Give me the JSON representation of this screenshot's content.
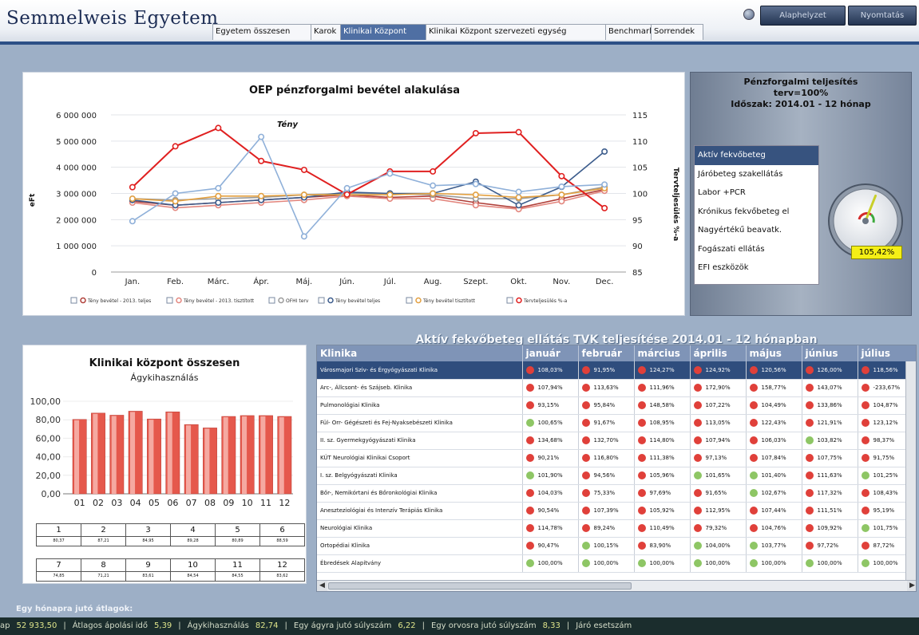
{
  "app": {
    "title": "Semmelweis Egyetem"
  },
  "tabs": [
    {
      "label": "Egyetem összesen"
    },
    {
      "label": "Karok"
    },
    {
      "label": "Klinikai Központ"
    },
    {
      "label": "Klinikai Központ szervezeti egység"
    },
    {
      "label": "Benchmark"
    },
    {
      "label": "Sorrendek"
    }
  ],
  "top_buttons": {
    "reset": "Alaphelyzet",
    "print": "Nyomtatás"
  },
  "main_chart": {
    "title": "OEP pénzforgalmi bevétel alakulása",
    "ylabel_left": "eFt",
    "ylabel_right": "Tervteljesülés %-a",
    "annotation": "Tény",
    "legend": [
      {
        "label": "Tény bevétel - 2013. teljes",
        "color": "#b0403a"
      },
      {
        "label": "Tény bevétel - 2013. tisztított",
        "color": "#e3877f"
      },
      {
        "label": "OFHI terv",
        "color": "#9b9b9b"
      },
      {
        "label": "Tény bevétel teljes",
        "color": "#3c5c8c"
      },
      {
        "label": "Tény bevétel tisztított",
        "color": "#e3a040"
      },
      {
        "label": "Tervteljesülés %-a",
        "color": "#e02020"
      }
    ]
  },
  "chart_data": {
    "type": "line",
    "title": "OEP pénzforgalmi bevétel alakulása",
    "ylabel": "eFt",
    "y2label": "Tervteljesülés %-a",
    "categories": [
      "Jan.",
      "Feb.",
      "Márc.",
      "Ápr.",
      "Máj.",
      "Jún.",
      "Júl.",
      "Aug.",
      "Szept.",
      "Okt.",
      "Nov.",
      "Dec."
    ],
    "ylim": [
      0,
      6000000
    ],
    "y2lim": [
      85,
      115
    ],
    "yticks": [
      "0",
      "1 000 000",
      "2 000 000",
      "3 000 000",
      "4 000 000",
      "5 000 000",
      "6 000 000"
    ],
    "y2ticks": [
      "85",
      "90",
      "95",
      "100",
      "105",
      "110",
      "115"
    ],
    "legend_position": "bottom",
    "series": [
      {
        "name": "Tény bevétel - 2013. teljes",
        "axis": "left",
        "color": "#b0403a",
        "values": [
          2700000,
          2550000,
          2650000,
          2750000,
          2850000,
          2950000,
          2850000,
          2900000,
          2650000,
          2450000,
          2800000,
          3150000
        ]
      },
      {
        "name": "Tény bevétel - 2013. tisztított",
        "axis": "left",
        "color": "#e3877f",
        "values": [
          2650000,
          2450000,
          2550000,
          2650000,
          2750000,
          2900000,
          2800000,
          2800000,
          2550000,
          2400000,
          2700000,
          3100000
        ]
      },
      {
        "name": "OFHI terv",
        "axis": "left",
        "color": "#9b9b9b",
        "values": [
          2800000,
          2750000,
          2800000,
          2850000,
          2950000,
          3000000,
          3000000,
          2950000,
          2800000,
          2800000,
          2950000,
          3250000
        ]
      },
      {
        "name": "Tény bevétel teljes",
        "axis": "left",
        "color": "#3c5c8c",
        "values": [
          2750000,
          2550000,
          2650000,
          2750000,
          2850000,
          3050000,
          3000000,
          3000000,
          3450000,
          2550000,
          3250000,
          4600000
        ]
      },
      {
        "name": "Tény bevétel tisztított",
        "axis": "left",
        "color": "#e3a040",
        "values": [
          2800000,
          2700000,
          2900000,
          2900000,
          2950000,
          2950000,
          2950000,
          3000000,
          2950000,
          2850000,
          2950000,
          3200000
        ]
      },
      {
        "name": "Tervteljesülés %-a",
        "axis": "right",
        "color": "#e02020",
        "values": [
          101.2,
          109.0,
          112.5,
          106.2,
          104.5,
          99.8,
          104.2,
          104.2,
          111.5,
          111.7,
          103.3,
          97.2
        ]
      },
      {
        "name": "",
        "axis": "right",
        "color": "#8fb0d9",
        "values": [
          94.7,
          100.0,
          101.0,
          110.8,
          91.8,
          101.0,
          103.8,
          101.5,
          101.8,
          100.3,
          101.3,
          101.7
        ]
      }
    ]
  },
  "perf": {
    "title1": "Pénzforgalmi teljesítés",
    "title2": "terv=100%",
    "title3": "Időszak: 2014.01 - 12 hónap",
    "items": [
      "Aktív fekvőbeteg",
      "Járóbeteg szakellátás",
      "Labor +PCR",
      "Krónikus fekvőbeteg el",
      "Nagyértékű beavatk.",
      "Fogászati ellátás",
      "EFI eszközök"
    ],
    "gauge_value": "105,42%",
    "gauge_percent": 105.42
  },
  "bar_chart": {
    "title": "Klinikai központ összesen",
    "subtitle": "Ágykihasználás",
    "color": "#e5584c",
    "categories": [
      "01",
      "02",
      "03",
      "04",
      "05",
      "06",
      "07",
      "08",
      "09",
      "10",
      "11",
      "12"
    ],
    "values": [
      80.37,
      87.21,
      84.95,
      89.28,
      80.89,
      88.59,
      74.85,
      71.21,
      83.61,
      84.54,
      84.55,
      83.62
    ],
    "yticks": [
      "0,00",
      "20,00",
      "40,00",
      "60,00",
      "80,00",
      "100,00"
    ],
    "ylim": [
      0,
      100
    ]
  },
  "month_grid": {
    "row1": {
      "months": [
        "1",
        "2",
        "3",
        "4",
        "5",
        "6"
      ],
      "values": [
        "80,37",
        "87,21",
        "84,95",
        "89,28",
        "80,89",
        "88,59"
      ]
    },
    "row2": {
      "months": [
        "7",
        "8",
        "9",
        "10",
        "11",
        "12"
      ],
      "values": [
        "74,85",
        "71,21",
        "83,61",
        "84,54",
        "84,55",
        "83,62"
      ]
    }
  },
  "table": {
    "title": "Aktív fekvőbeteg ellátás TVK teljesítése 2014.01 - 12 hónapban",
    "headers": [
      "Klinika",
      "január",
      "február",
      "március",
      "április",
      "május",
      "június",
      "július"
    ],
    "rows": [
      {
        "name": "Városmajori Sziv- és Érgyógyászati Klinika",
        "selected": true,
        "cells": [
          {
            "v": "108,03%",
            "s": "red"
          },
          {
            "v": "91,95%",
            "s": "red"
          },
          {
            "v": "124,27%",
            "s": "red"
          },
          {
            "v": "124,92%",
            "s": "red"
          },
          {
            "v": "120,56%",
            "s": "red"
          },
          {
            "v": "126,00%",
            "s": "red"
          },
          {
            "v": "118,56%",
            "s": "red"
          }
        ]
      },
      {
        "name": "Arc-, Állcsont- és Szájseb. Klinika",
        "selected": false,
        "cells": [
          {
            "v": "107,94%",
            "s": "red"
          },
          {
            "v": "113,63%",
            "s": "red"
          },
          {
            "v": "111,96%",
            "s": "red"
          },
          {
            "v": "172,90%",
            "s": "red"
          },
          {
            "v": "158,77%",
            "s": "red"
          },
          {
            "v": "143,07%",
            "s": "red"
          },
          {
            "v": "-233,67%",
            "s": "red"
          }
        ]
      },
      {
        "name": "Pulmonológiai Klinika",
        "selected": false,
        "cells": [
          {
            "v": "93,15%",
            "s": "red"
          },
          {
            "v": "95,84%",
            "s": "red"
          },
          {
            "v": "148,58%",
            "s": "red"
          },
          {
            "v": "107,22%",
            "s": "red"
          },
          {
            "v": "104,49%",
            "s": "red"
          },
          {
            "v": "133,86%",
            "s": "red"
          },
          {
            "v": "104,87%",
            "s": "red"
          }
        ]
      },
      {
        "name": "Fül- Orr- Gégészeti és Fej-Nyaksebészeti Klinika",
        "selected": false,
        "cells": [
          {
            "v": "100,65%",
            "s": "green"
          },
          {
            "v": "91,67%",
            "s": "red"
          },
          {
            "v": "108,95%",
            "s": "red"
          },
          {
            "v": "113,05%",
            "s": "red"
          },
          {
            "v": "122,43%",
            "s": "red"
          },
          {
            "v": "121,91%",
            "s": "red"
          },
          {
            "v": "123,12%",
            "s": "red"
          }
        ]
      },
      {
        "name": "II. sz. Gyermekgyógyászati Klinika",
        "selected": false,
        "cells": [
          {
            "v": "134,68%",
            "s": "red"
          },
          {
            "v": "132,70%",
            "s": "red"
          },
          {
            "v": "114,80%",
            "s": "red"
          },
          {
            "v": "107,94%",
            "s": "red"
          },
          {
            "v": "106,03%",
            "s": "red"
          },
          {
            "v": "103,82%",
            "s": "green"
          },
          {
            "v": "98,37%",
            "s": "red"
          }
        ]
      },
      {
        "name": "KÚT Neurológiai Klinikai Csoport",
        "selected": false,
        "cells": [
          {
            "v": "90,21%",
            "s": "red"
          },
          {
            "v": "116,80%",
            "s": "red"
          },
          {
            "v": "111,38%",
            "s": "red"
          },
          {
            "v": "97,13%",
            "s": "red"
          },
          {
            "v": "107,84%",
            "s": "red"
          },
          {
            "v": "107,75%",
            "s": "red"
          },
          {
            "v": "91,75%",
            "s": "red"
          }
        ]
      },
      {
        "name": "I. sz. Belgyógyászati Klinika",
        "selected": false,
        "cells": [
          {
            "v": "101,90%",
            "s": "green"
          },
          {
            "v": "94,56%",
            "s": "red"
          },
          {
            "v": "105,96%",
            "s": "red"
          },
          {
            "v": "101,65%",
            "s": "green"
          },
          {
            "v": "101,40%",
            "s": "green"
          },
          {
            "v": "111,63%",
            "s": "red"
          },
          {
            "v": "101,25%",
            "s": "green"
          }
        ]
      },
      {
        "name": "Bőr-, Nemikórtani és Bőronkológiai Klinika",
        "selected": false,
        "cells": [
          {
            "v": "104,03%",
            "s": "red"
          },
          {
            "v": "75,33%",
            "s": "red"
          },
          {
            "v": "97,69%",
            "s": "red"
          },
          {
            "v": "91,65%",
            "s": "red"
          },
          {
            "v": "102,67%",
            "s": "green"
          },
          {
            "v": "117,32%",
            "s": "red"
          },
          {
            "v": "108,43%",
            "s": "red"
          }
        ]
      },
      {
        "name": "Aneszteziológiai és Intenzív Terápiás Klinika",
        "selected": false,
        "cells": [
          {
            "v": "90,54%",
            "s": "red"
          },
          {
            "v": "107,39%",
            "s": "red"
          },
          {
            "v": "105,92%",
            "s": "red"
          },
          {
            "v": "112,95%",
            "s": "red"
          },
          {
            "v": "107,44%",
            "s": "red"
          },
          {
            "v": "111,51%",
            "s": "red"
          },
          {
            "v": "95,19%",
            "s": "red"
          }
        ]
      },
      {
        "name": "Neurológiai Klinika",
        "selected": false,
        "cells": [
          {
            "v": "114,78%",
            "s": "red"
          },
          {
            "v": "89,24%",
            "s": "red"
          },
          {
            "v": "110,49%",
            "s": "red"
          },
          {
            "v": "79,32%",
            "s": "red"
          },
          {
            "v": "104,76%",
            "s": "red"
          },
          {
            "v": "109,92%",
            "s": "red"
          },
          {
            "v": "101,75%",
            "s": "green"
          }
        ]
      },
      {
        "name": "Ortopédiai Klinika",
        "selected": false,
        "cells": [
          {
            "v": "90,47%",
            "s": "red"
          },
          {
            "v": "100,15%",
            "s": "green"
          },
          {
            "v": "83,90%",
            "s": "red"
          },
          {
            "v": "104,00%",
            "s": "green"
          },
          {
            "v": "103,77%",
            "s": "green"
          },
          {
            "v": "97,72%",
            "s": "red"
          },
          {
            "v": "87,72%",
            "s": "red"
          }
        ]
      },
      {
        "name": "Ébredések Alapítvány",
        "selected": false,
        "cells": [
          {
            "v": "100,00%",
            "s": "green"
          },
          {
            "v": "100,00%",
            "s": "green"
          },
          {
            "v": "100,00%",
            "s": "green"
          },
          {
            "v": "100,00%",
            "s": "green"
          },
          {
            "v": "100,00%",
            "s": "green"
          },
          {
            "v": "100,00%",
            "s": "green"
          },
          {
            "v": "100,00%",
            "s": "green"
          }
        ]
      }
    ]
  },
  "colors": {
    "red": "#e0403a",
    "green": "#8ec665"
  },
  "footer": {
    "label": "Egy hónapra jutó átlagok:",
    "stats": [
      {
        "label": "ap",
        "value": "52 933,50"
      },
      {
        "label": "Átlagos ápolási idő",
        "value": "5,39"
      },
      {
        "label": "Ágykihasználás",
        "value": "82,74"
      },
      {
        "label": "Egy ágyra jutó súlyszám",
        "value": "6,22"
      },
      {
        "label": "Egy orvosra jutó súlyszám",
        "value": "8,33"
      },
      {
        "label": "Járó esetszám",
        "value": ""
      }
    ]
  }
}
